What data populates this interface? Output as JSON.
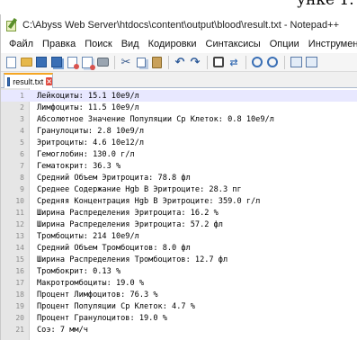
{
  "page_top_text": "унке 1.",
  "window": {
    "title": "C:\\Abyss Web Server\\htdocs\\content\\output\\blood\\result.txt - Notepad++"
  },
  "menu": {
    "items": [
      "Файл",
      "Правка",
      "Поиск",
      "Вид",
      "Кодировки",
      "Синтаксисы",
      "Опции",
      "Инструменты"
    ]
  },
  "toolbar": {
    "icons": [
      "new-file-icon",
      "open-folder-icon",
      "save-icon",
      "save-all-icon",
      "close-icon",
      "close-all-icon",
      "print-icon",
      "cut-icon",
      "copy-icon",
      "paste-icon",
      "undo-icon",
      "redo-icon",
      "find-icon",
      "replace-icon",
      "zoom-in-icon",
      "zoom-out-icon",
      "sync-vertical-icon",
      "sync-horizontal-icon"
    ]
  },
  "tab": {
    "label": "result.txt",
    "close_glyph": "×"
  },
  "editor": {
    "lines": [
      {
        "num": "1",
        "text": "Лейкоциты: 15.1 10e9/л"
      },
      {
        "num": "2",
        "text": "Лимфоциты: 11.5 10e9/л"
      },
      {
        "num": "3",
        "text": "Абсолютное Значение Популяции Ср Клеток: 0.8 10e9/л"
      },
      {
        "num": "4",
        "text": "Гранулоциты: 2.8 10e9/л"
      },
      {
        "num": "5",
        "text": "Эритроциты: 4.6 10e12/л"
      },
      {
        "num": "6",
        "text": "Гемоглобин: 130.0 г/л"
      },
      {
        "num": "7",
        "text": "Гематокрит: 36.3 %"
      },
      {
        "num": "8",
        "text": "Средний Объем Эритроцита: 78.8 фл"
      },
      {
        "num": "9",
        "text": "Среднее Содержание Hgb В Эритроците: 28.3 пг"
      },
      {
        "num": "10",
        "text": "Средняя Концентрация Hgb В Эритроците: 359.0 г/л"
      },
      {
        "num": "11",
        "text": "Ширина Распределения Эритроцита: 16.2 %"
      },
      {
        "num": "12",
        "text": "Ширина Распределения Эритроцита: 57.2 фл"
      },
      {
        "num": "13",
        "text": "Тромбоциты: 214 10e9/л"
      },
      {
        "num": "14",
        "text": "Средний Объем Тромбоцитов: 8.0 фл"
      },
      {
        "num": "15",
        "text": "Ширина Распределения Тромбоцитов: 12.7 фл"
      },
      {
        "num": "16",
        "text": "Тромбокрит: 0.13 %"
      },
      {
        "num": "17",
        "text": "Макротромбоциты: 19.0 %"
      },
      {
        "num": "18",
        "text": "Процент Лимфоцитов: 76.3 %"
      },
      {
        "num": "19",
        "text": "Процент Популяции Ср Клеток: 4.7 %"
      },
      {
        "num": "20",
        "text": "Процент Гранулоцитов: 19.0 %"
      },
      {
        "num": "21",
        "text": "Соэ: 7 мм/ч"
      }
    ]
  }
}
